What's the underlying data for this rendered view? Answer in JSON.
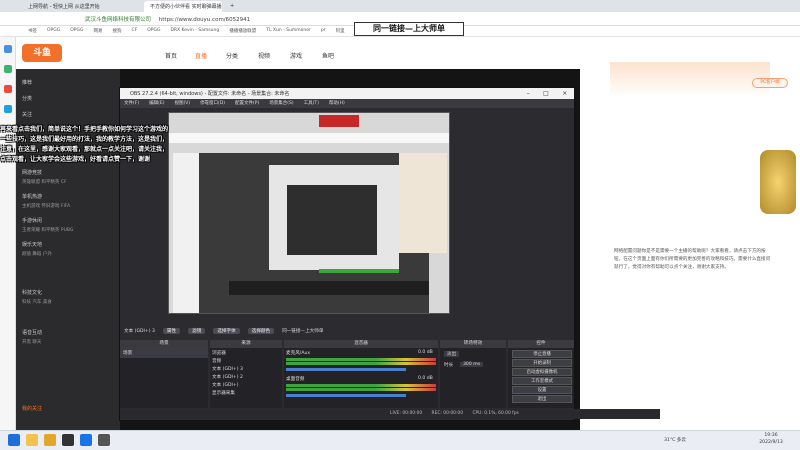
{
  "browser": {
    "tabs": [
      {
        "label": "上网导航 - 轻快上网 从这里开始",
        "active": false
      },
      {
        "label": "不方便的小伙伴看 实时聊弹幕播",
        "active": true
      }
    ],
    "url": "https://www.douyu.com/6052941",
    "site_label": "武汉斗鱼网络科技有限公司",
    "bookmarks": [
      "书签",
      "OPGG",
      "OPGG",
      "网易",
      "搜狗",
      "CF",
      "OPGG",
      "DRX Kevin - Samsung",
      "播播播放联盟",
      "TL Xun - Summoner",
      "pr",
      "阿里",
      "火狐",
      "CF",
      "刷",
      "不只是",
      "当代鬼画"
    ]
  },
  "douyu": {
    "logo": "斗鱼",
    "nav": [
      "首页",
      "直播",
      "分类",
      "视频",
      "游戏",
      "鱼吧"
    ],
    "active_nav": "直播",
    "pc_button": "PC客户端",
    "sidebar": [
      {
        "label": "推荐",
        "sub": ""
      },
      {
        "label": "分类",
        "sub": ""
      },
      {
        "label": "关注",
        "sub": ""
      },
      {
        "label": "网游竞技",
        "sub": "英雄联盟  和平精英  CF"
      },
      {
        "label": "单机热游",
        "sub": "主机游戏  怀旧游戏  FIFA"
      },
      {
        "label": "手游休闲",
        "sub": "王者荣耀  和平精英  PUBG"
      },
      {
        "label": "娱乐天地",
        "sub": "颜值  舞蹈  户外"
      },
      {
        "label": "科技文化",
        "sub": "科技  汽车  美食"
      },
      {
        "label": "语音互动",
        "sub": "开黑  聊天"
      },
      {
        "label": "我的关注",
        "sub": ""
      }
    ],
    "right_text": "网络配置问题你是不是需要一个主播的帮助呢？大家看看，请点击下方的按钮，在这个页面上面有你们所需要的更加完善的攻略和技巧。需要什么直接问就行了，觉得对你有帮助可以点个关注，谢谢大家支持。",
    "banner": "同一链接—上大师单"
  },
  "obs": {
    "title": "OBS 27.2.4 (64-bit, windows) - 配置文件: 未命名 - 场景集合: 未命名",
    "menu": [
      "文件(F)",
      "编辑(E)",
      "视图(V)",
      "停靠窗口(D)",
      "配置文件(P)",
      "场景集合(S)",
      "工具(T)",
      "帮助(H)"
    ],
    "toolbar": {
      "current_source": "文本 (GDI+) 3",
      "properties": "属性",
      "filters": "滤镜",
      "select_font": "选择字体",
      "select_color": "选择颜色",
      "text": "同一链接—上大师单"
    },
    "docks": {
      "scenes": "场景",
      "sources": "来源",
      "mixer": "混音器",
      "transitions": "转场特效",
      "controls": "控件"
    },
    "scene_list": [
      "场景"
    ],
    "sources": [
      "浏览器",
      "音频",
      "文本 (GDI+) 3",
      "文本 (GDI+) 2",
      "文本 (GDI+)",
      "显示器采集"
    ],
    "mixer": [
      {
        "name": "麦克风/Aux",
        "db": "0.0 dB"
      },
      {
        "name": "桌面音频",
        "db": "0.0 dB"
      }
    ],
    "transition": {
      "type": "淡出",
      "duration_label": "时长",
      "duration": "300 ms"
    },
    "controls": [
      "停止直播",
      "开始录制",
      "启动虚拟摄像机",
      "工作室模式",
      "设置",
      "退出"
    ],
    "status": {
      "live": "LIVE: 00:00:00",
      "rec": "REC: 00:00:00",
      "cpu": "CPU: 0.1%, 60.00 fps"
    }
  },
  "overlay_text": "再来看点击我们，简单说这个！手把手教你如何学习这个游戏的一些技巧，这是我们最好用的打法，我的教学方法，这是我们，注意，在这里，感谢大家观看，那就点一点关注吧，请关注我，点击观看，让大家学会这些游戏，好看请点赞一下，谢谢",
  "taskbar": {
    "weather": "31°C 多云",
    "time": "19:36",
    "date": "2022/9/13"
  },
  "colors": {
    "accent": "#f3702b",
    "obs_bg": "#2c2c30",
    "live_red": "#c62828"
  }
}
